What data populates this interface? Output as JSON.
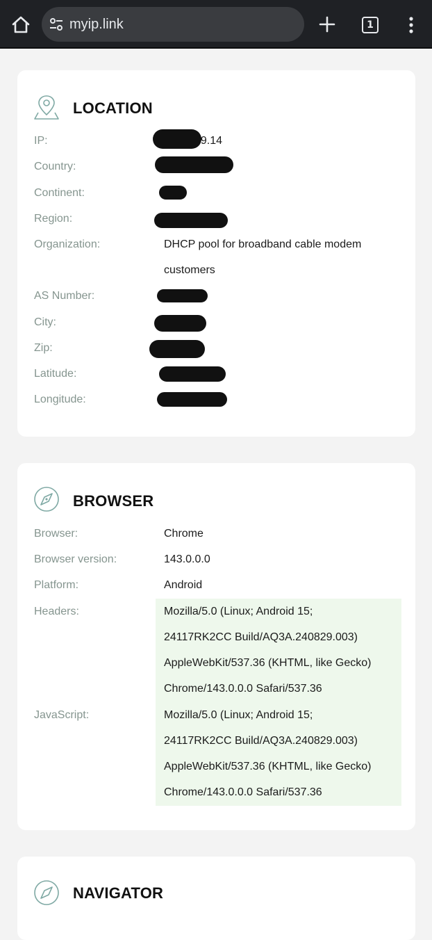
{
  "browser_ui": {
    "url": "myip.link",
    "tab_count": "1"
  },
  "location": {
    "title": "LOCATION",
    "rows": [
      {
        "label": "IP:",
        "value": "49.14"
      },
      {
        "label": "Country:",
        "value": ""
      },
      {
        "label": "Continent:",
        "value": ""
      },
      {
        "label": "Region:",
        "value": ""
      },
      {
        "label": "Organization:",
        "value_line1": "DHCP pool for broadband cable modem",
        "value_line2": "customers"
      },
      {
        "label": "AS Number:",
        "value": ""
      },
      {
        "label": "City:",
        "value": ""
      },
      {
        "label": "Zip:",
        "value": ""
      },
      {
        "label": "Latitude:",
        "value": ""
      },
      {
        "label": "Longitude:",
        "value": ""
      }
    ]
  },
  "browser": {
    "title": "BROWSER",
    "browser_label": "Browser:",
    "browser_value": "Chrome",
    "version_label": "Browser version:",
    "version_value": "143.0.0.0",
    "platform_label": "Platform:",
    "platform_value": "Android",
    "headers_label": "Headers:",
    "headers_lines": [
      "Mozilla/5.0 (Linux; Android 15;",
      "24117RK2CC Build/AQ3A.240829.003)",
      "AppleWebKit/537.36 (KHTML, like Gecko)",
      "Chrome/143.0.0.0 Safari/537.36"
    ],
    "js_label": "JavaScript:",
    "js_lines": [
      "Mozilla/5.0 (Linux; Android 15;",
      "24117RK2CC Build/AQ3A.240829.003)",
      "AppleWebKit/537.36 (KHTML, like Gecko)",
      "Chrome/143.0.0.0 Safari/537.36"
    ]
  },
  "navigator": {
    "title": "NAVIGATOR"
  }
}
